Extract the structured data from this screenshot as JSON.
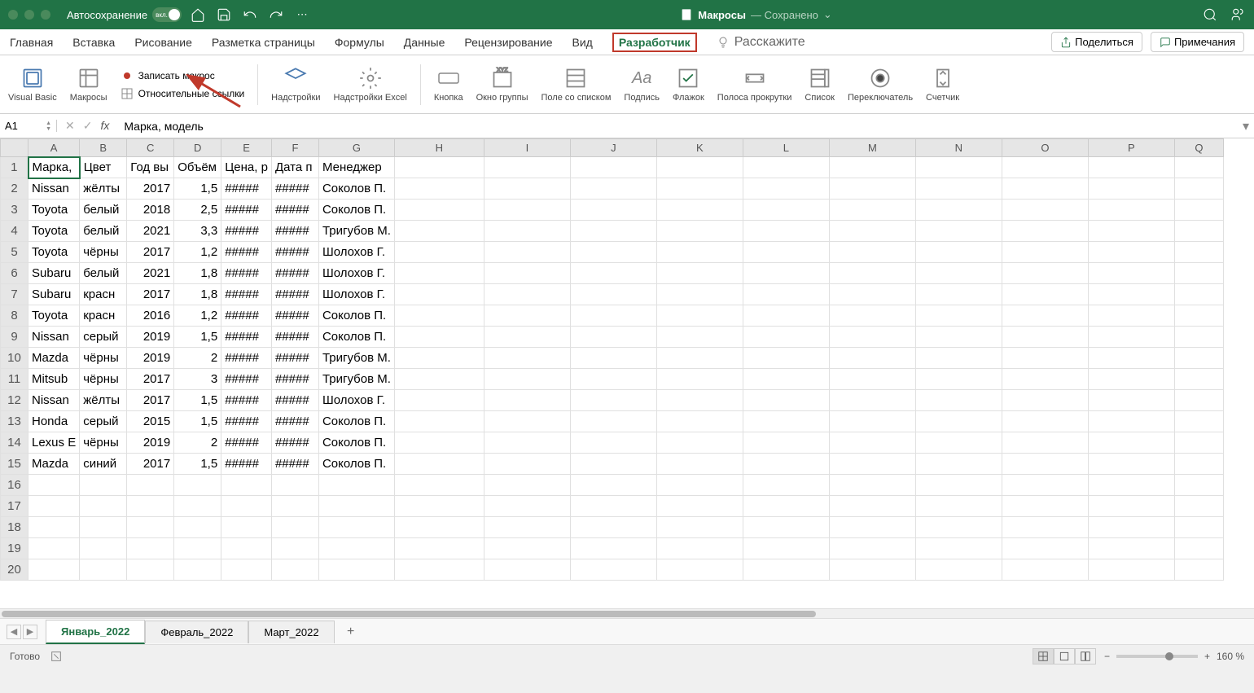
{
  "titlebar": {
    "autosave_label": "Автосохранение",
    "autosave_state": "вкл.",
    "doc_name": "Макросы",
    "doc_status": "— Сохранено"
  },
  "ribbon_tabs": {
    "home": "Главная",
    "insert": "Вставка",
    "draw": "Рисование",
    "layout": "Разметка страницы",
    "formulas": "Формулы",
    "data": "Данные",
    "review": "Рецензирование",
    "view": "Вид",
    "developer": "Разработчик",
    "tell_me": "Расскажите",
    "share": "Поделиться",
    "comments": "Примечания"
  },
  "ribbon": {
    "visual_basic": "Visual Basic",
    "macros": "Макросы",
    "record_macro": "Записать макрос",
    "relative_refs": "Относительные ссылки",
    "addins": "Надстройки",
    "excel_addins": "Надстройки Excel",
    "button": "Кнопка",
    "groupbox": "Окно группы",
    "listbox": "Поле со списком",
    "label": "Подпись",
    "checkbox": "Флажок",
    "scrollbar": "Полоса прокрутки",
    "list": "Список",
    "radio": "Переключатель",
    "spinner": "Счетчик"
  },
  "formula_bar": {
    "cell_ref": "A1",
    "fx_label": "fx",
    "formula": "Марка, модель"
  },
  "columns": [
    "A",
    "B",
    "C",
    "D",
    "E",
    "F",
    "G",
    "H",
    "I",
    "J",
    "K",
    "L",
    "M",
    "N",
    "O",
    "P",
    "Q"
  ],
  "headers": [
    "Марка,",
    "Цвет",
    "Год вы",
    "Объём",
    "Цена, р",
    "Дата п",
    "Менеджер"
  ],
  "rows": [
    [
      "Nissan",
      "жёлты",
      "2017",
      "1,5",
      "#####",
      "#####",
      "Соколов П."
    ],
    [
      "Toyota",
      "белый",
      "2018",
      "2,5",
      "#####",
      "#####",
      "Соколов П."
    ],
    [
      "Toyota",
      "белый",
      "2021",
      "3,3",
      "#####",
      "#####",
      "Тригубов М."
    ],
    [
      "Toyota",
      "чёрны",
      "2017",
      "1,2",
      "#####",
      "#####",
      "Шолохов Г."
    ],
    [
      "Subaru",
      "белый",
      "2021",
      "1,8",
      "#####",
      "#####",
      "Шолохов Г."
    ],
    [
      "Subaru",
      "красн",
      "2017",
      "1,8",
      "#####",
      "#####",
      "Шолохов Г."
    ],
    [
      "Toyota",
      "красн",
      "2016",
      "1,2",
      "#####",
      "#####",
      "Соколов П."
    ],
    [
      "Nissan",
      "серый",
      "2019",
      "1,5",
      "#####",
      "#####",
      "Соколов П."
    ],
    [
      "Mazda",
      "чёрны",
      "2019",
      "2",
      "#####",
      "#####",
      "Тригубов М."
    ],
    [
      "Mitsub",
      "чёрны",
      "2017",
      "3",
      "#####",
      "#####",
      "Тригубов М."
    ],
    [
      "Nissan",
      "жёлты",
      "2017",
      "1,5",
      "#####",
      "#####",
      "Шолохов Г."
    ],
    [
      "Honda",
      "серый",
      "2015",
      "1,5",
      "#####",
      "#####",
      "Соколов П."
    ],
    [
      "Lexus E",
      "чёрны",
      "2019",
      "2",
      "#####",
      "#####",
      "Соколов П."
    ],
    [
      "Mazda",
      "синий",
      "2017",
      "1,5",
      "#####",
      "#####",
      "Соколов П."
    ]
  ],
  "sheet_tabs": {
    "jan": "Январь_2022",
    "feb": "Февраль_2022",
    "mar": "Март_2022"
  },
  "status": {
    "ready": "Готово",
    "zoom": "160 %"
  }
}
